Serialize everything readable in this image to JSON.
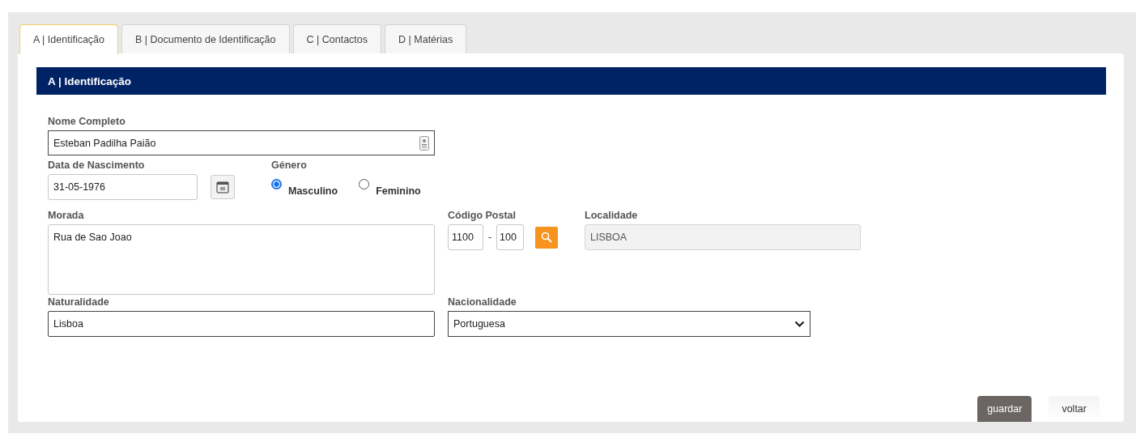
{
  "tabs": [
    {
      "label": "A | Identificação",
      "selected": true
    },
    {
      "label": "B | Documento de Identificação",
      "selected": false
    },
    {
      "label": "C | Contactos",
      "selected": false
    },
    {
      "label": "D | Matérias",
      "selected": false
    }
  ],
  "section": {
    "title": "A | Identificação"
  },
  "nome": {
    "label": "Nome Completo",
    "value": "Esteban Padilha Paião"
  },
  "data_nascimento": {
    "label": "Data de Nascimento",
    "value": "31-05-1976"
  },
  "genero": {
    "label": "Género",
    "options": [
      {
        "label": "Masculino",
        "selected": true
      },
      {
        "label": "Feminino",
        "selected": false
      }
    ]
  },
  "morada": {
    "label": "Morada",
    "value": "Rua de Sao Joao"
  },
  "codigo_postal": {
    "label": "Código Postal",
    "parts": [
      "1100",
      "100"
    ],
    "separator": "-"
  },
  "localidade": {
    "label": "Localidade",
    "value": "LISBOA",
    "disabled": true
  },
  "naturalidade": {
    "label": "Naturalidade",
    "value": "Lisboa"
  },
  "nacionalidade": {
    "label": "Nacionalidade",
    "value": "Portuguesa"
  },
  "buttons": [
    {
      "label": "guardar",
      "kind": "primary"
    },
    {
      "label": "voltar",
      "kind": "secondary"
    }
  ]
}
